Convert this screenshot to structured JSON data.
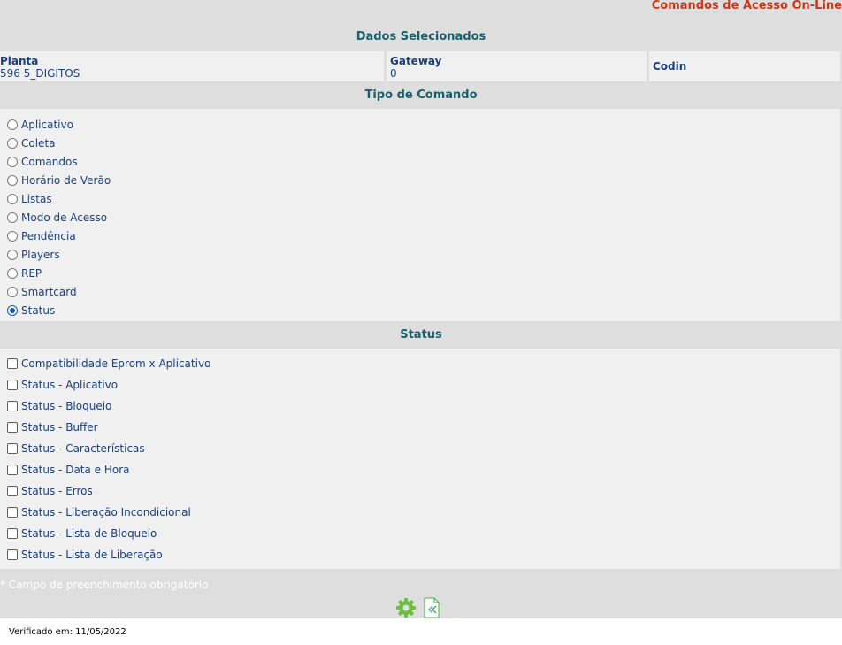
{
  "app_title": "Comandos de Acesso On-Line",
  "selected": {
    "header": "Dados Selecionados",
    "planta_label": "Planta",
    "planta_value": "596 5_DIGITOS",
    "gateway_label": "Gateway",
    "gateway_value": "0",
    "codin_label": "Codin"
  },
  "tipo_comando": {
    "header": "Tipo de Comando",
    "options": [
      {
        "label": "Aplicativo",
        "checked": false
      },
      {
        "label": "Coleta",
        "checked": false
      },
      {
        "label": "Comandos",
        "checked": false
      },
      {
        "label": "Horário de Verão",
        "checked": false
      },
      {
        "label": "Listas",
        "checked": false
      },
      {
        "label": "Modo de Acesso",
        "checked": false
      },
      {
        "label": "Pendência",
        "checked": false
      },
      {
        "label": "Players",
        "checked": false
      },
      {
        "label": "REP",
        "checked": false
      },
      {
        "label": "Smartcard",
        "checked": false
      },
      {
        "label": "Status",
        "checked": true
      }
    ]
  },
  "status": {
    "header": "Status",
    "options": [
      {
        "label": "Compatibilidade Eprom x Aplicativo",
        "checked": false
      },
      {
        "label": "Status - Aplicativo",
        "checked": false
      },
      {
        "label": "Status - Bloqueio",
        "checked": false
      },
      {
        "label": "Status - Buffer",
        "checked": false
      },
      {
        "label": "Status - Características",
        "checked": false
      },
      {
        "label": "Status - Data e Hora",
        "checked": false
      },
      {
        "label": "Status - Erros",
        "checked": false
      },
      {
        "label": "Status - Liberação Incondicional",
        "checked": false
      },
      {
        "label": "Status - Lista de Bloqueio",
        "checked": false
      },
      {
        "label": "Status - Lista de Liberação",
        "checked": false
      }
    ]
  },
  "required_note": "* Campo de preenchimento obrigatório",
  "footer": "Verificado em: 11/05/2022",
  "colors": {
    "title": "#c8381a",
    "header": "#1b5f6b",
    "text": "#1a3f7a",
    "gear": "#6cbf3f"
  }
}
